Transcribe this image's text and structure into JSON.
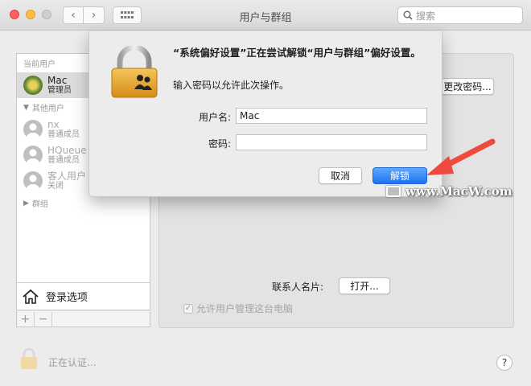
{
  "window": {
    "title": "用户与群组",
    "search_placeholder": "搜索"
  },
  "sidebar": {
    "current_users_header": "当前用户",
    "current_user": {
      "name": "Mac",
      "role": "管理员"
    },
    "other_users_header": "其他用户",
    "other_users": [
      {
        "name": "nx",
        "role": "普通成员"
      },
      {
        "name": "HQueue",
        "role": "普通成员"
      },
      {
        "name": "客人用户",
        "role": "关闭"
      }
    ],
    "groups_label": "群组",
    "login_options": "登录选项",
    "add": "+",
    "remove": "−"
  },
  "main": {
    "change_password": "更改密码...",
    "contact_card_label": "联系人名片:",
    "open_button": "打开...",
    "allow_admin": "允许用户管理这台电脑"
  },
  "footer": {
    "auth_text": "正在认证...",
    "help": "?"
  },
  "dialog": {
    "title": "“系统偏好设置”正在尝试解锁“用户与群组”偏好设置。",
    "subtitle": "输入密码以允许此次操作。",
    "username_label": "用户名:",
    "username_value": "Mac",
    "password_label": "密码:",
    "password_value": "",
    "cancel": "取消",
    "unlock": "解锁"
  },
  "watermark": "www.MacW.com",
  "colors": {
    "accent": "#1d72f2",
    "arrow": "#ef4a3d"
  }
}
